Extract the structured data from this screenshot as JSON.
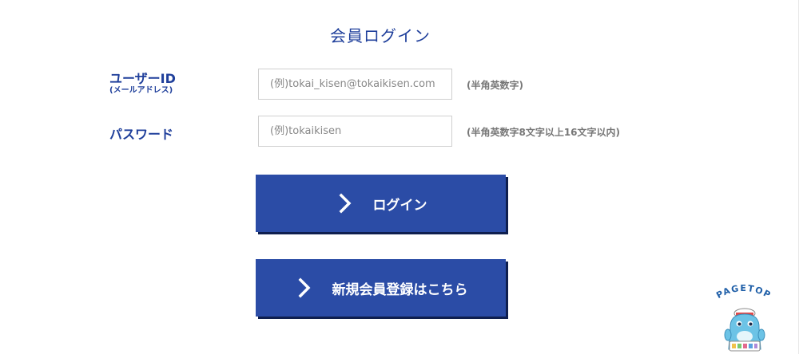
{
  "page": {
    "title": "会員ログイン"
  },
  "form": {
    "userid_label": "ユーザーID",
    "userid_sublabel": "(メールアドレス)",
    "userid_placeholder": "(例)tokai_kisen@tokaikisen.com",
    "userid_hint": "(半角英数字)",
    "password_label": "パスワード",
    "password_placeholder": "(例)tokaikisen",
    "password_hint": "(半角英数字8文字以上16文字以内)"
  },
  "buttons": {
    "login_label": "ログイン",
    "register_label": "新規会員登録はこちら"
  },
  "pagetop": {
    "label": "PAGETOP"
  },
  "colors": {
    "brand_blue": "#2b4ca6",
    "title_blue": "#1f3f9b",
    "button_shadow": "#0f1f4f"
  },
  "icons": {
    "button_icon": "chevron-right-icon",
    "mascot": "mascot-icon"
  }
}
